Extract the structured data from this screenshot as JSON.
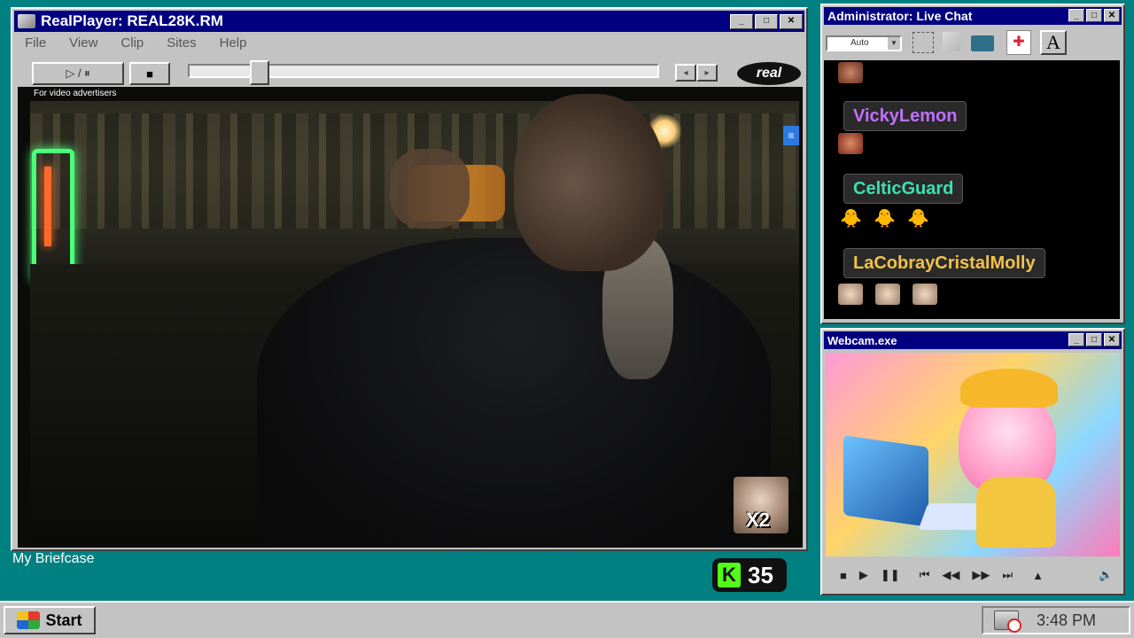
{
  "realplayer": {
    "title": "RealPlayer: REAL28K.RM",
    "menu": [
      "File",
      "View",
      "Clip",
      "Sites",
      "Help"
    ],
    "play_pause_label": "▷ / ⏸",
    "stop_label": "■",
    "logo_text": "real",
    "caption": "For video advertisers",
    "badge_multiplier": "X2"
  },
  "desktop": {
    "briefcase_label": "My Briefcase",
    "score": "35",
    "score_letter": "K"
  },
  "chat": {
    "title": "Administrator: Live Chat",
    "font_select": "Auto",
    "font_button": "A",
    "messages": [
      {
        "user": "VickyLemon",
        "color": "#c070ff"
      },
      {
        "user": "CelticGuard",
        "color": "#3de0b0"
      },
      {
        "user": "LaCobrayCristalMolly",
        "color": "#f2c24a"
      }
    ]
  },
  "webcam": {
    "title": "Webcam.exe"
  },
  "taskbar": {
    "start_label": "Start",
    "clock": "3:48 PM"
  }
}
